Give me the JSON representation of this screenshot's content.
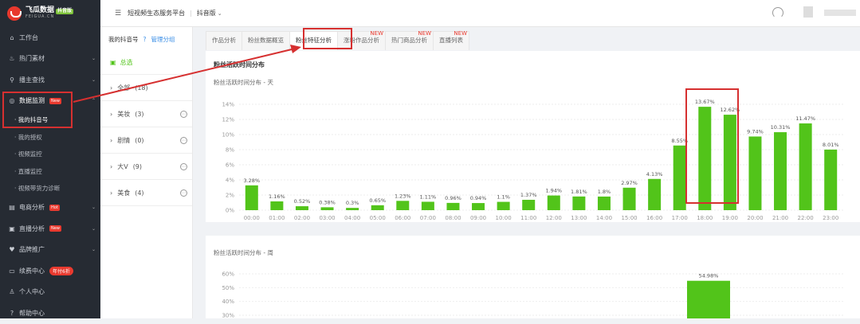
{
  "sidebar": {
    "logo_title": "飞瓜数据",
    "logo_badge": "抖音版",
    "logo_sub": "FEIGUA.CN",
    "items": [
      {
        "label": "工作台"
      },
      {
        "label": "热门素材"
      },
      {
        "label": "播主查找"
      },
      {
        "label": "数据监测",
        "badge": "New"
      },
      {
        "label": "我的抖音号"
      },
      {
        "label": "我的授权"
      },
      {
        "label": "视频监控"
      },
      {
        "label": "直播监控"
      },
      {
        "label": "视频带货力诊断"
      },
      {
        "label": "电商分析",
        "badge": "Hot"
      },
      {
        "label": "直播分析",
        "badge": "New"
      },
      {
        "label": "品牌推广"
      },
      {
        "label": "续费中心",
        "badge": "年付6折"
      },
      {
        "label": "个人中心"
      },
      {
        "label": "帮助中心"
      }
    ]
  },
  "topbar": {
    "platform": "短视频生态服务平台",
    "version": "抖音版"
  },
  "accounts": {
    "title": "我的抖音号",
    "manage": "管理分组",
    "all": "总选",
    "groups": [
      {
        "label": "全部",
        "count": "(18)"
      },
      {
        "label": "美妆",
        "count": "(3)"
      },
      {
        "label": "剧情",
        "count": "(0)"
      },
      {
        "label": "大V",
        "count": "(9)"
      },
      {
        "label": "美食",
        "count": "(4)"
      }
    ]
  },
  "tabs": [
    {
      "label": "作品分析"
    },
    {
      "label": "粉丝数据概览"
    },
    {
      "label": "粉丝特征分析"
    },
    {
      "label": "涨粉作品分析",
      "new": "NEW"
    },
    {
      "label": "热门商品分析",
      "new": "NEW"
    },
    {
      "label": "直播列表",
      "new": "NEW"
    }
  ],
  "section_title": "粉丝活跃时间分布",
  "chart_data": [
    {
      "type": "bar",
      "title": "粉丝活跃时间分布 - 天",
      "categories": [
        "00:00",
        "01:00",
        "02:00",
        "03:00",
        "04:00",
        "05:00",
        "06:00",
        "07:00",
        "08:00",
        "09:00",
        "10:00",
        "11:00",
        "12:00",
        "13:00",
        "14:00",
        "15:00",
        "16:00",
        "17:00",
        "18:00",
        "19:00",
        "20:00",
        "21:00",
        "22:00",
        "23:00"
      ],
      "values": [
        3.28,
        1.16,
        0.52,
        0.38,
        0.3,
        0.65,
        1.23,
        1.11,
        0.96,
        0.94,
        1.1,
        1.37,
        1.94,
        1.81,
        1.8,
        2.97,
        4.13,
        8.55,
        13.67,
        12.62,
        9.74,
        10.31,
        11.47,
        8.01
      ],
      "value_labels": [
        "3.28%",
        "1.16%",
        "0.52%",
        "0.38%",
        "0.3%",
        "0.65%",
        "1.23%",
        "1.11%",
        "0.96%",
        "0.94%",
        "1.1%",
        "1.37%",
        "1.94%",
        "1.81%",
        "1.8%",
        "2.97%",
        "4.13%",
        "8.55%",
        "13.67%",
        "12.62%",
        "9.74%",
        "10.31%",
        "11.47%",
        "8.01%"
      ],
      "yticks": [
        "0%",
        "2%",
        "4%",
        "6%",
        "8%",
        "10%",
        "12%",
        "14%"
      ],
      "ylim": [
        0,
        14
      ],
      "grid": true,
      "color": "#52c41a"
    },
    {
      "type": "bar",
      "title": "粉丝活跃时间分布 - 周",
      "values": [
        54.98
      ],
      "value_labels": [
        "54.98%"
      ],
      "yticks": [
        "30%",
        "40%",
        "50%",
        "60%"
      ],
      "ylim": [
        30,
        60
      ],
      "grid": true,
      "color": "#52c41a"
    }
  ]
}
